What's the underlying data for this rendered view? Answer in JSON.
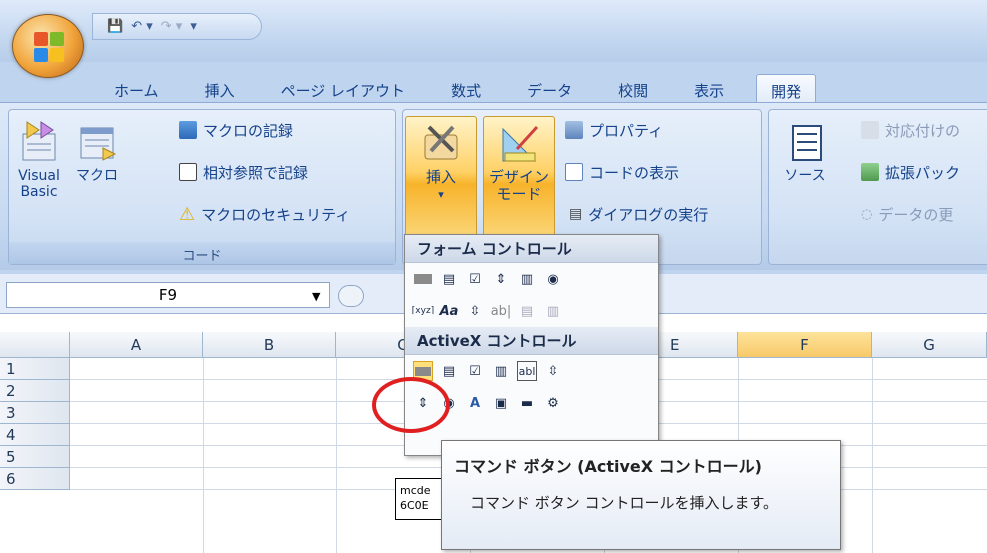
{
  "qat": {
    "save_icon": "save-icon",
    "undo_icon": "undo-icon",
    "redo_icon": "redo-icon"
  },
  "tabs": [
    "ホーム",
    "挿入",
    "ページ レイアウト",
    "数式",
    "データ",
    "校閲",
    "表示",
    "開発"
  ],
  "active_tab": "開発",
  "ribbon": {
    "code_group": {
      "label": "コード",
      "visual_basic": "Visual Basic",
      "macro": "マクロ",
      "record_macro": "マクロの記録",
      "relative_ref": "相対参照で記録",
      "macro_security": "マクロのセキュリティ"
    },
    "controls_group": {
      "insert": "挿入",
      "design_mode_line1": "デザイン",
      "design_mode_line2": "モード",
      "properties": "プロパティ",
      "view_code": "コードの表示",
      "run_dialog": "ダイアログの実行"
    },
    "xml_group": {
      "source": "ソース",
      "map_properties": "対応付けの",
      "expansion_packs": "拡張パック",
      "refresh_data": "データの更"
    }
  },
  "namebox": "F9",
  "columns": [
    "A",
    "B",
    "C",
    "E",
    "F",
    "G"
  ],
  "selected_column": "F",
  "rows": [
    "1",
    "2",
    "3",
    "4",
    "5",
    "6"
  ],
  "popup": {
    "form_controls_header": "フォーム コントロール",
    "activex_header": "ActiveX コントロール"
  },
  "tooltip": {
    "title": "コマンド ボタン (ActiveX コントロール)",
    "body": "コマンド ボタン コントロールを挿入します。"
  },
  "cell_fragment": {
    "line1": "mcde",
    "line2": "6C0E"
  }
}
